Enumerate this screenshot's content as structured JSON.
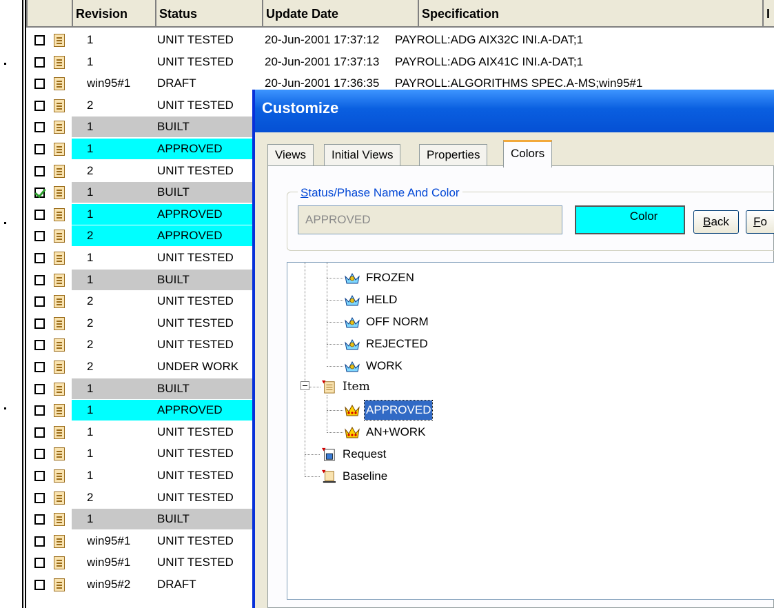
{
  "grid": {
    "headers": [
      "Revision",
      "Status",
      "Update Date",
      "Specification",
      "I"
    ],
    "rows": [
      {
        "checked": false,
        "revision": "1",
        "status": "UNIT TESTED",
        "date": "20-Jun-2001 17:37:12",
        "spec": "PAYROLL:ADG AIX32C INI.A-DAT;1",
        "extra": "",
        "band": "none"
      },
      {
        "checked": false,
        "revision": "1",
        "status": "UNIT TESTED",
        "date": "20-Jun-2001 17:37:13",
        "spec": "PAYROLL:ADG AIX41C INI.A-DAT;1",
        "extra": "",
        "band": "none"
      },
      {
        "checked": false,
        "revision": "win95#1",
        "status": "DRAFT",
        "date": "20-Jun-2001 17:36:35",
        "spec": "PAYROLL:ALGORITHMS SPEC.A-MS;win95#1",
        "extra": "",
        "band": "none"
      },
      {
        "checked": false,
        "revision": "2",
        "status": "UNIT TESTED",
        "date": "",
        "spec": "",
        "extra": "",
        "band": "none"
      },
      {
        "checked": false,
        "revision": "1",
        "status": "BUILT",
        "date": "",
        "spec": "",
        "extra": "",
        "band": "gray"
      },
      {
        "checked": false,
        "revision": "1",
        "status": "APPROVED",
        "date": "",
        "spec": "",
        "extra": "",
        "band": "cyan"
      },
      {
        "checked": false,
        "revision": "2",
        "status": "UNIT TESTED",
        "date": "",
        "spec": "",
        "extra": "",
        "band": "none"
      },
      {
        "checked": true,
        "revision": "1",
        "status": "BUILT",
        "date": "",
        "spec": "",
        "extra": "",
        "band": "gray"
      },
      {
        "checked": false,
        "revision": "1",
        "status": "APPROVED",
        "date": "",
        "spec": "",
        "extra": "",
        "band": "cyan"
      },
      {
        "checked": false,
        "revision": "2",
        "status": "APPROVED",
        "date": "",
        "spec": "",
        "extra": "",
        "band": "cyan"
      },
      {
        "checked": false,
        "revision": "1",
        "status": "UNIT TESTED",
        "date": "",
        "spec": "",
        "extra": "",
        "band": "none"
      },
      {
        "checked": false,
        "revision": "1",
        "status": "BUILT",
        "date": "",
        "spec": "",
        "extra": "",
        "band": "gray"
      },
      {
        "checked": false,
        "revision": "2",
        "status": "UNIT TESTED",
        "date": "",
        "spec": "",
        "extra": "",
        "band": "none"
      },
      {
        "checked": false,
        "revision": "2",
        "status": "UNIT TESTED",
        "date": "",
        "spec": "",
        "extra": "",
        "band": "none"
      },
      {
        "checked": false,
        "revision": "2",
        "status": "UNIT TESTED",
        "date": "",
        "spec": "",
        "extra": "",
        "band": "none"
      },
      {
        "checked": false,
        "revision": "2",
        "status": "UNDER WORK",
        "date": "",
        "spec": "",
        "extra": "",
        "band": "none"
      },
      {
        "checked": false,
        "revision": "1",
        "status": "BUILT",
        "date": "",
        "spec": "",
        "extra": "",
        "band": "gray"
      },
      {
        "checked": false,
        "revision": "1",
        "status": "APPROVED",
        "date": "",
        "spec": "",
        "extra": "",
        "band": "cyan"
      },
      {
        "checked": false,
        "revision": "1",
        "status": "UNIT TESTED",
        "date": "",
        "spec": "",
        "extra": "",
        "band": "none"
      },
      {
        "checked": false,
        "revision": "1",
        "status": "UNIT TESTED",
        "date": "",
        "spec": "",
        "extra": "",
        "band": "none"
      },
      {
        "checked": false,
        "revision": "1",
        "status": "UNIT TESTED",
        "date": "",
        "spec": "",
        "extra": "",
        "band": "none"
      },
      {
        "checked": false,
        "revision": "2",
        "status": "UNIT TESTED",
        "date": "",
        "spec": "",
        "extra": "",
        "band": "none"
      },
      {
        "checked": false,
        "revision": "1",
        "status": "BUILT",
        "date": "",
        "spec": "",
        "extra": "",
        "band": "gray"
      },
      {
        "checked": false,
        "revision": "win95#1",
        "status": "UNIT TESTED",
        "date": "",
        "spec": "",
        "extra": "",
        "band": "none"
      },
      {
        "checked": false,
        "revision": "win95#1",
        "status": "UNIT TESTED",
        "date": "",
        "spec": "",
        "extra": "",
        "band": "none"
      },
      {
        "checked": false,
        "revision": "win95#2",
        "status": "DRAFT",
        "date": "",
        "spec": "",
        "extra": "",
        "band": "none"
      }
    ],
    "band_colors": {
      "gray": "#c8c8c8",
      "cyan": "#00ffff"
    }
  },
  "dialog": {
    "title": "Customize",
    "tabs": [
      {
        "label": "Views",
        "active": false
      },
      {
        "label": "Initial Views",
        "active": false
      },
      {
        "label": "Properties",
        "active": false
      },
      {
        "label": "Colors",
        "active": true
      }
    ],
    "group_label_accel": "S",
    "group_label_rest": "tatus/Phase Name And Color",
    "name_value": "APPROVED",
    "color_button_label": "Color",
    "color_value": "#00ffff",
    "back_accel": "B",
    "back_rest": "ack",
    "forward_accel": "F",
    "forward_rest": "o",
    "tree": {
      "status_nodes": [
        "FROZEN",
        "HELD",
        "OFF NORM",
        "REJECTED",
        "WORK"
      ],
      "item_label": "Item",
      "item_children": [
        "APPROVED",
        "AN+WORK"
      ],
      "selected": "APPROVED",
      "request_label": "Request",
      "baseline_label": "Baseline"
    }
  }
}
